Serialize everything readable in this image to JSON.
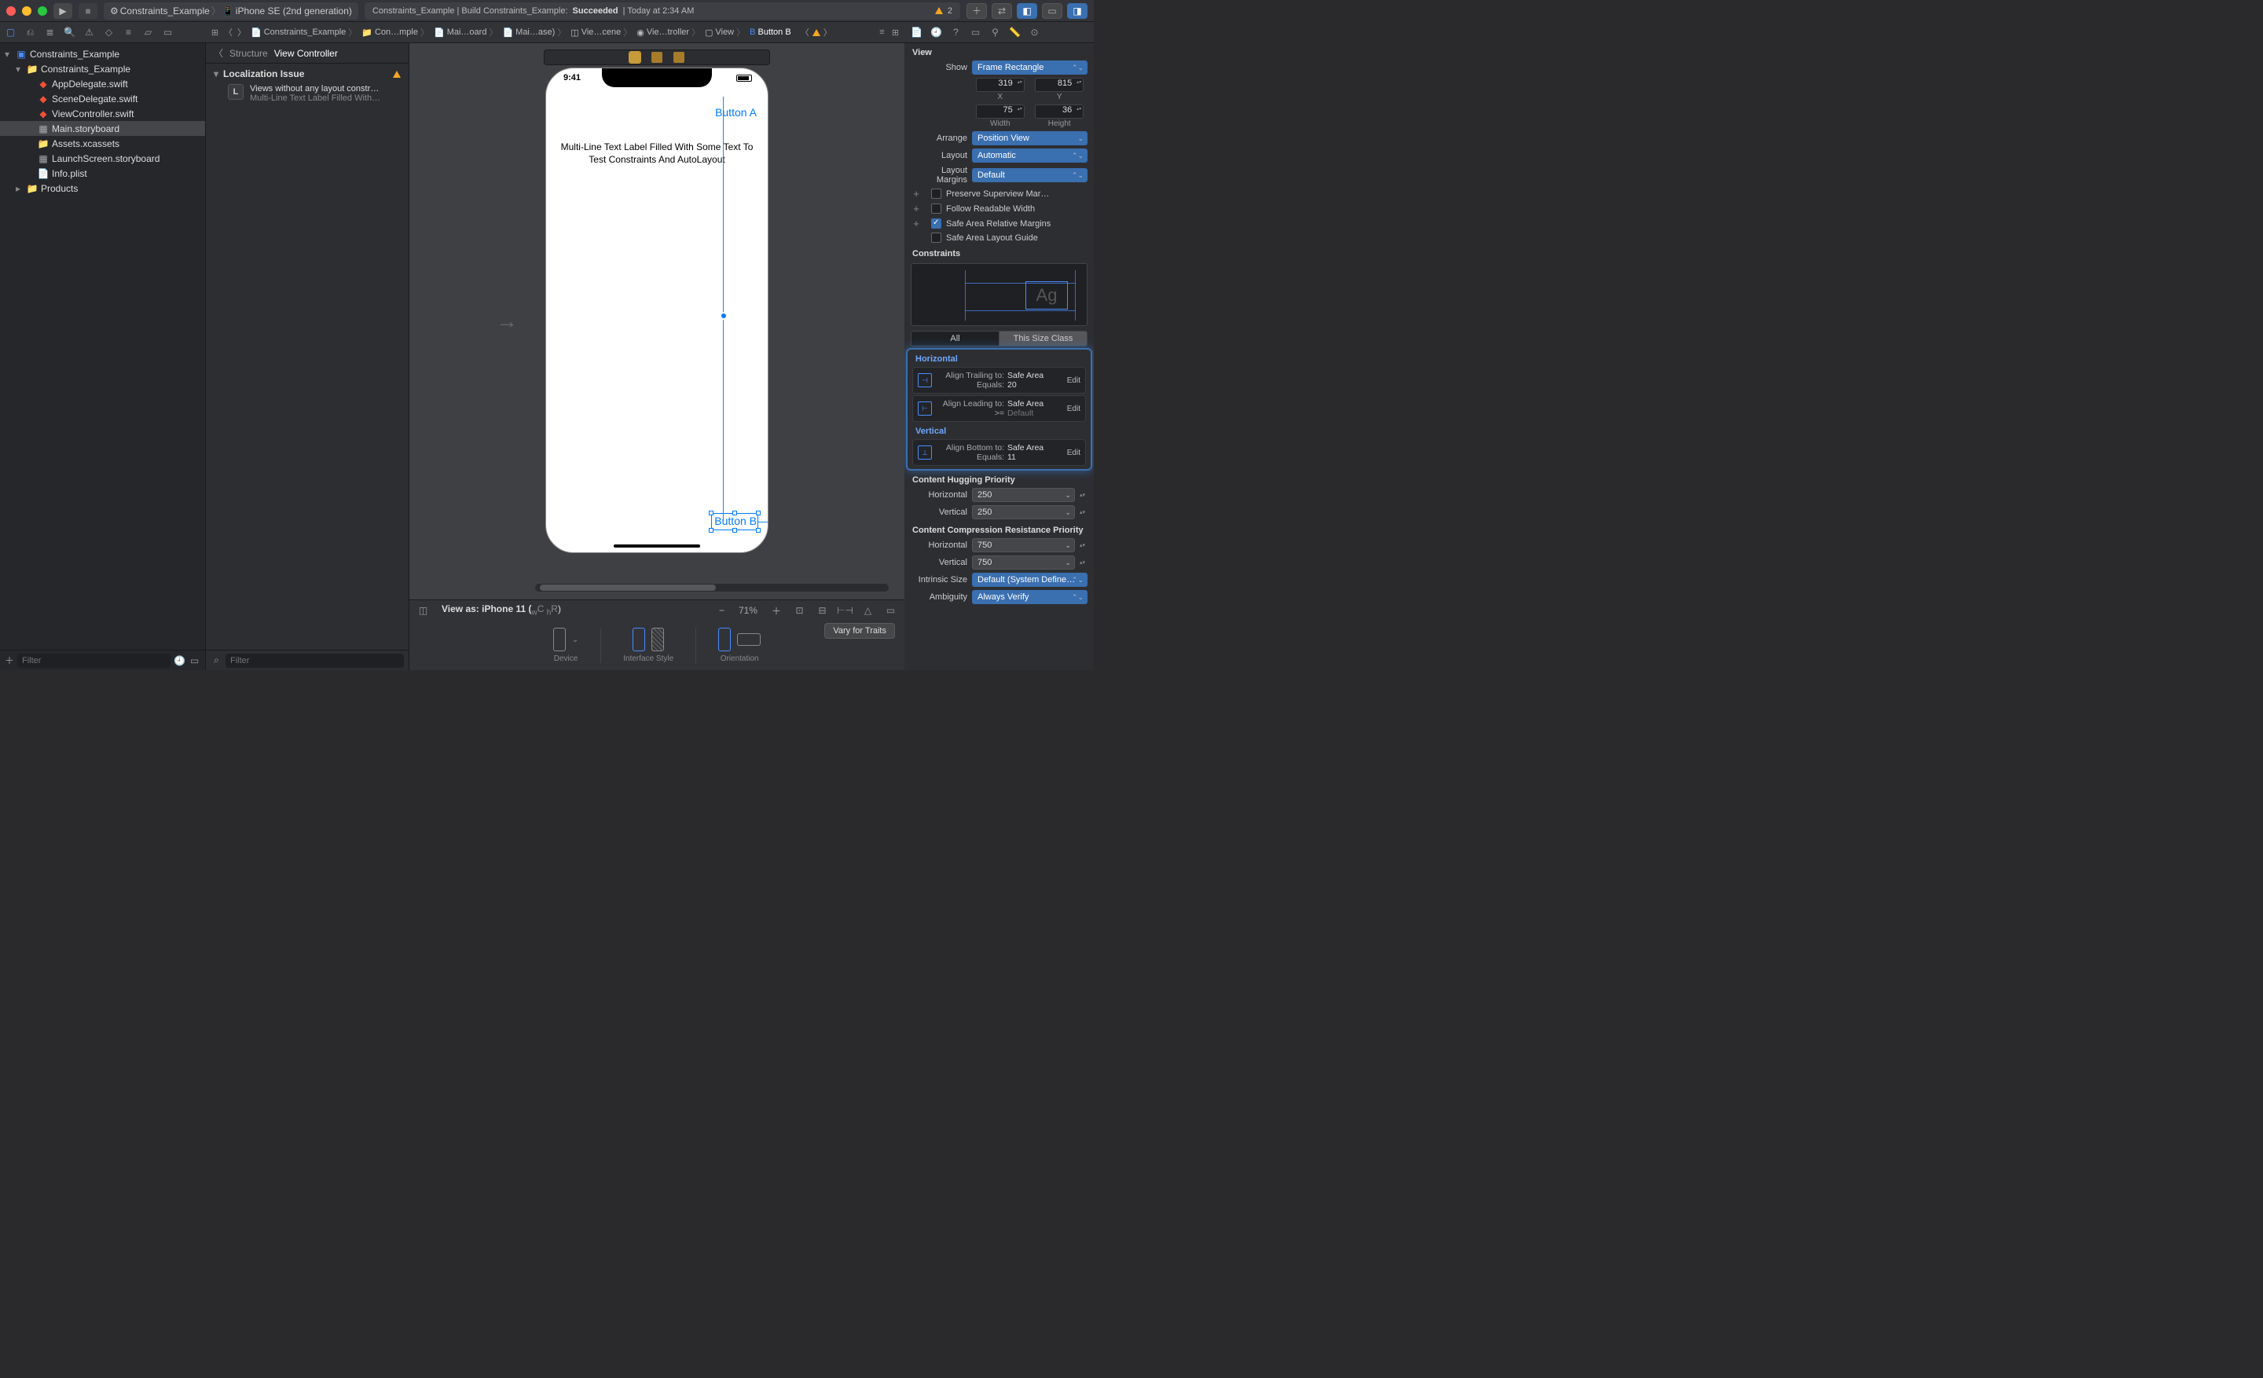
{
  "titlebar": {
    "scheme": "Constraints_Example",
    "device": "iPhone SE (2nd generation)",
    "status_prefix": "Constraints_Example | Build Constraints_Example: ",
    "status_result": "Succeeded",
    "status_time": " | Today at 2:34 AM",
    "warn_count": "2"
  },
  "path": [
    "Constraints_Example",
    "Con…mple",
    "Mai…oard",
    "Mai…ase)",
    "Vie…cene",
    "Vie…troller",
    "View",
    "Button B"
  ],
  "nav": {
    "root": "Constraints_Example",
    "group": "Constraints_Example",
    "files": [
      "AppDelegate.swift",
      "SceneDelegate.swift",
      "ViewController.swift",
      "Main.storyboard",
      "Assets.xcassets",
      "LaunchScreen.storyboard",
      "Info.plist"
    ],
    "products": "Products",
    "filter_ph": "Filter"
  },
  "outline": {
    "back": "Structure",
    "title": "View Controller",
    "section": "Localization Issue",
    "issue_t1": "Views without any layout constr…",
    "issue_t2": "Multi-Line Text Label Filled With…",
    "filter_ph": "Filter"
  },
  "canvas": {
    "time": "9:41",
    "buttonA": "Button A",
    "label": "Multi-Line Text Label Filled With Some Text To Test Constraints And AutoLayout",
    "buttonB": "Button B",
    "viewas_pre": "View as: ",
    "viewas_dev": "iPhone 11 (",
    "viewas_trait": "wC hR",
    "viewas_close": ")",
    "zoom": "71%",
    "vary": "Vary for Traits",
    "grp_device": "Device",
    "grp_style": "Interface Style",
    "grp_orient": "Orientation"
  },
  "insp": {
    "head_view": "View",
    "show": "Show",
    "show_v": "Frame Rectangle",
    "x": "319",
    "y": "815",
    "xl": "X",
    "yl": "Y",
    "w": "75",
    "h": "36",
    "wl": "Width",
    "hl": "Height",
    "arrange": "Arrange",
    "arrange_v": "Position View",
    "layout": "Layout",
    "layout_v": "Automatic",
    "margins": "Layout Margins",
    "margins_v": "Default",
    "cb1": "Preserve Superview Mar…",
    "cb2": "Follow Readable Width",
    "cb3": "Safe Area Relative Margins",
    "cb4": "Safe Area Layout Guide",
    "constraints_h": "Constraints",
    "seg_all": "All",
    "seg_this": "This Size Class",
    "horiz": "Horizontal",
    "c1_k1": "Align Trailing to:",
    "c1_v1": "Safe Area",
    "c1_k2": "Equals:",
    "c1_v2": "20",
    "c2_k1": "Align Leading to:",
    "c2_v1": "Safe Area",
    "c2_k2": ">=",
    "c2_v2": "Default",
    "vert": "Vertical",
    "c3_k1": "Align Bottom to:",
    "c3_v1": "Safe Area",
    "c3_k2": "Equals:",
    "c3_v2": "11",
    "edit": "Edit",
    "chug": "Content Hugging Priority",
    "chug_h": "Horizontal",
    "chug_hv": "250",
    "chug_v": "Vertical",
    "chug_vv": "250",
    "ccomp": "Content Compression Resistance Priority",
    "ccomp_hv": "750",
    "ccomp_vv": "750",
    "isize": "Intrinsic Size",
    "isize_v": "Default (System Define…",
    "amb": "Ambiguity",
    "amb_v": "Always Verify"
  }
}
